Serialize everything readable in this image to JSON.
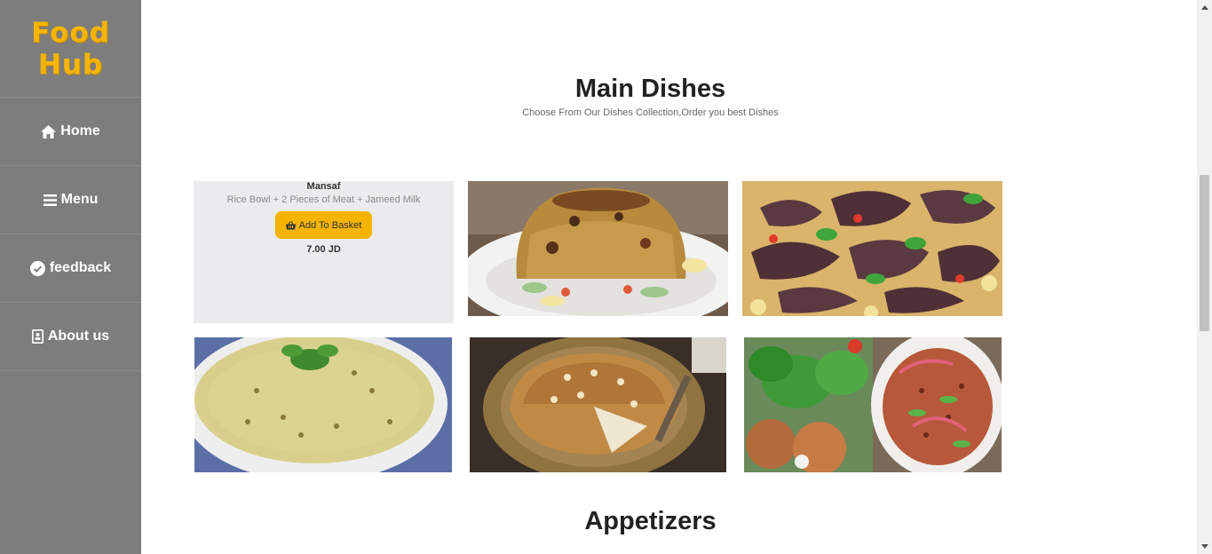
{
  "sidebar": {
    "logo_line1": "Food",
    "logo_line2": "Hub",
    "items": [
      {
        "label": "Home",
        "icon": "home-icon"
      },
      {
        "label": "Menu",
        "icon": "bars-icon"
      },
      {
        "label": "feedback",
        "icon": "check-circle-icon"
      },
      {
        "label": "About us",
        "icon": "address-book-icon"
      }
    ]
  },
  "main_dishes": {
    "title": "Main Dishes",
    "subtitle": "Choose From Our Dishes Collection,Order you best Dishes",
    "featured": {
      "name": "Mansaf",
      "description": "Rice Bowl + 2 Pieces of Meat + Jameed Milk",
      "button_label": "Add To Basket",
      "button_icon": "basket-icon",
      "price": "7.00 JD"
    },
    "images": [
      "maqluba-image",
      "mansaf-meat-image",
      "lentil-soup-image",
      "pie-image",
      "kofta-salad-image"
    ]
  },
  "appetizers": {
    "title": "Appetizers"
  },
  "colors": {
    "sidebar_bg": "#7d7d7d",
    "accent": "#f5b400",
    "card_bg": "#ebebed"
  }
}
